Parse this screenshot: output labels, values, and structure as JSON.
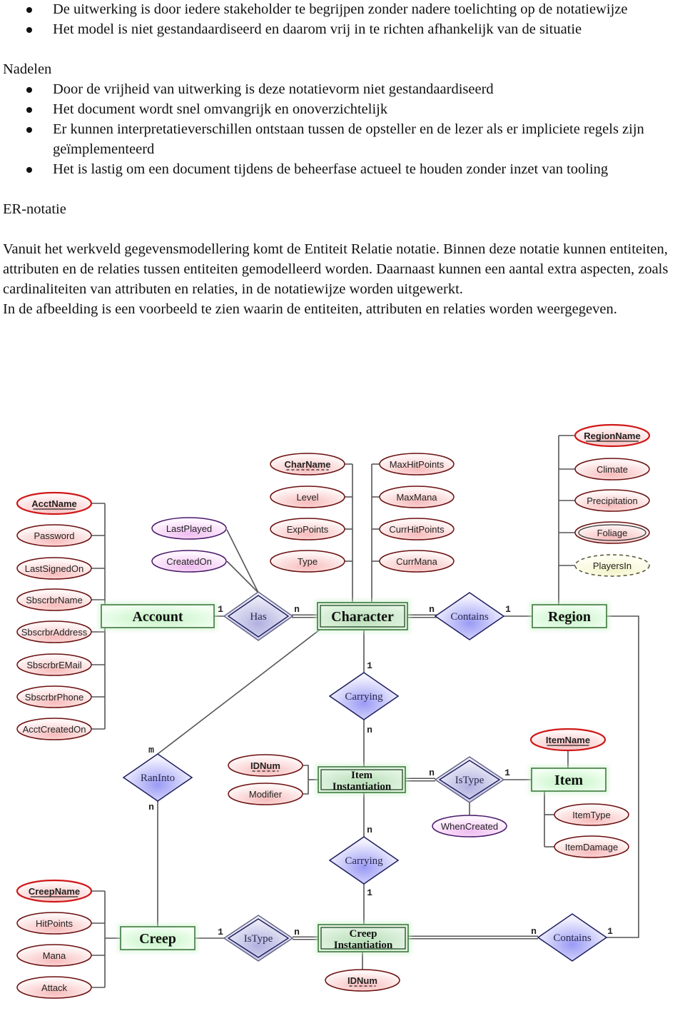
{
  "document": {
    "voordelen_bullets": [
      "De uitwerking is door iedere stakeholder te begrijpen zonder nadere toelichting op de notatiewijze",
      "Het model is niet gestandaardiseerd en daarom vrij in te richten afhankelijk van de situatie"
    ],
    "nadelen_heading": "Nadelen",
    "nadelen_bullets": [
      "Door de vrijheid van uitwerking is deze notatievorm niet gestandaardiseerd",
      "Het document wordt snel omvangrijk en onoverzichtelijk",
      "Er kunnen interpretatieverschillen ontstaan tussen de opsteller en de lezer als er impliciete regels zijn geïmplementeerd",
      "Het is lastig om een document tijdens de beheerfase actueel te houden zonder inzet van tooling"
    ],
    "er_heading": "ER-notatie",
    "paragraph_1": "Vanuit het werkveld gegevensmodellering komt de Entiteit Relatie notatie. Binnen deze notatie kunnen entiteiten, attributen en de relaties tussen entiteiten gemodelleerd worden. Daarnaast kunnen een aantal extra aspecten, zoals cardinaliteiten van attributen en relaties, in de notatiewijze worden uitgewerkt.",
    "paragraph_2": "In de afbeelding is een voorbeeld te zien waarin de entiteiten, attributen en relaties worden weergegeven."
  },
  "colors": {
    "entity_fill": "#d9f5d9",
    "entity_stroke": "#3c7a3c",
    "relationship_fill": "#c8c8f5",
    "relationship_stroke": "#1c1c5c",
    "attribute_fill": "#fbd9d9",
    "attribute_stroke": "#6b1010",
    "key_attribute_stroke": "#d01818",
    "relationship_attribute_fill": "#f5d6f5",
    "relationship_attribute_stroke": "#4a1a6a",
    "derived_attribute_fill": "#fafad6",
    "line": "#555555"
  },
  "er_diagram": {
    "entities": [
      {
        "id": "account",
        "label": "Account",
        "weak": false
      },
      {
        "id": "character",
        "label": "Character",
        "weak": true
      },
      {
        "id": "region",
        "label": "Region",
        "weak": false
      },
      {
        "id": "item_inst",
        "label": [
          "Item",
          "Instantiation"
        ],
        "weak": true
      },
      {
        "id": "item",
        "label": "Item",
        "weak": false
      },
      {
        "id": "creep",
        "label": "Creep",
        "weak": false
      },
      {
        "id": "creep_inst",
        "label": [
          "Creep",
          "Instantiation"
        ],
        "weak": true
      }
    ],
    "relationships": [
      {
        "id": "has",
        "label": "Has",
        "identifying": true
      },
      {
        "id": "contains_region",
        "label": "Contains",
        "identifying": false
      },
      {
        "id": "carrying_1",
        "label": "Carrying",
        "identifying": false
      },
      {
        "id": "ran_into",
        "label": "RanInto",
        "identifying": false
      },
      {
        "id": "istype_item",
        "label": "IsType",
        "identifying": true
      },
      {
        "id": "carrying_2",
        "label": "Carrying",
        "identifying": false
      },
      {
        "id": "istype_creep",
        "label": "IsType",
        "identifying": true
      },
      {
        "id": "contains_item",
        "label": "Contains",
        "identifying": false
      }
    ],
    "attributes": [
      {
        "id": "acctname",
        "label": "AcctName",
        "kind": "key"
      },
      {
        "id": "password",
        "label": "Password",
        "kind": "normal"
      },
      {
        "id": "lastsignedon",
        "label": "LastSignedOn",
        "kind": "normal"
      },
      {
        "id": "sbscrbrname",
        "label": "SbscrbrName",
        "kind": "normal"
      },
      {
        "id": "sbscrbraddress",
        "label": "SbscrbrAddress",
        "kind": "normal"
      },
      {
        "id": "sbscrbremail",
        "label": "SbscrbrEMail",
        "kind": "normal"
      },
      {
        "id": "sbscrbrphone",
        "label": "SbscrbrPhone",
        "kind": "normal"
      },
      {
        "id": "acctcreatedon",
        "label": "AcctCreatedOn",
        "kind": "normal"
      },
      {
        "id": "lastplayed",
        "label": "LastPlayed",
        "kind": "relationship"
      },
      {
        "id": "createdon",
        "label": "CreatedOn",
        "kind": "relationship"
      },
      {
        "id": "charname",
        "label": "CharName",
        "kind": "partial-key"
      },
      {
        "id": "level",
        "label": "Level",
        "kind": "normal"
      },
      {
        "id": "exppoints",
        "label": "ExpPoints",
        "kind": "normal"
      },
      {
        "id": "type",
        "label": "Type",
        "kind": "normal"
      },
      {
        "id": "maxhitpoints",
        "label": "MaxHitPoints",
        "kind": "normal"
      },
      {
        "id": "maxmana",
        "label": "MaxMana",
        "kind": "normal"
      },
      {
        "id": "currhitpoints",
        "label": "CurrHitPoints",
        "kind": "normal"
      },
      {
        "id": "currmana",
        "label": "CurrMana",
        "kind": "normal"
      },
      {
        "id": "regionname",
        "label": "RegionName",
        "kind": "key"
      },
      {
        "id": "climate",
        "label": "Climate",
        "kind": "normal"
      },
      {
        "id": "precipitation",
        "label": "Precipitation",
        "kind": "normal"
      },
      {
        "id": "foliage",
        "label": "Foliage",
        "kind": "multivalued"
      },
      {
        "id": "playersin",
        "label": "PlayersIn",
        "kind": "derived"
      },
      {
        "id": "idnum_item",
        "label": "IDNum",
        "kind": "partial-key"
      },
      {
        "id": "modifier",
        "label": "Modifier",
        "kind": "normal"
      },
      {
        "id": "whencreated",
        "label": "WhenCreated",
        "kind": "relationship"
      },
      {
        "id": "itemname",
        "label": "ItemName",
        "kind": "key"
      },
      {
        "id": "itemtype",
        "label": "ItemType",
        "kind": "normal"
      },
      {
        "id": "itemdamage",
        "label": "ItemDamage",
        "kind": "normal"
      },
      {
        "id": "creepname",
        "label": "CreepName",
        "kind": "key"
      },
      {
        "id": "hitpoints",
        "label": "HitPoints",
        "kind": "normal"
      },
      {
        "id": "mana",
        "label": "Mana",
        "kind": "normal"
      },
      {
        "id": "attack",
        "label": "Attack",
        "kind": "normal"
      },
      {
        "id": "idnum_creep",
        "label": "IDNum",
        "kind": "partial-key"
      }
    ],
    "cardinalities": [
      {
        "id": "has_account",
        "label": "1"
      },
      {
        "id": "has_character",
        "label": "n"
      },
      {
        "id": "contains_character",
        "label": "n"
      },
      {
        "id": "contains_region",
        "label": "1"
      },
      {
        "id": "carrying1_character",
        "label": "1"
      },
      {
        "id": "carrying1_iteminst",
        "label": "n"
      },
      {
        "id": "ranInto_character",
        "label": "m"
      },
      {
        "id": "ranInto_creep",
        "label": "n"
      },
      {
        "id": "istypeitem_iteminst",
        "label": "n"
      },
      {
        "id": "istypeitem_item",
        "label": "1"
      },
      {
        "id": "carrying2_iteminst",
        "label": "n"
      },
      {
        "id": "carrying2_creepinst",
        "label": "1"
      },
      {
        "id": "istypecreep_creep",
        "label": "1"
      },
      {
        "id": "istypecreep_creepinst",
        "label": "n"
      },
      {
        "id": "containsitem_creepinst",
        "label": "n"
      },
      {
        "id": "containsitem_region",
        "label": "1"
      }
    ]
  }
}
